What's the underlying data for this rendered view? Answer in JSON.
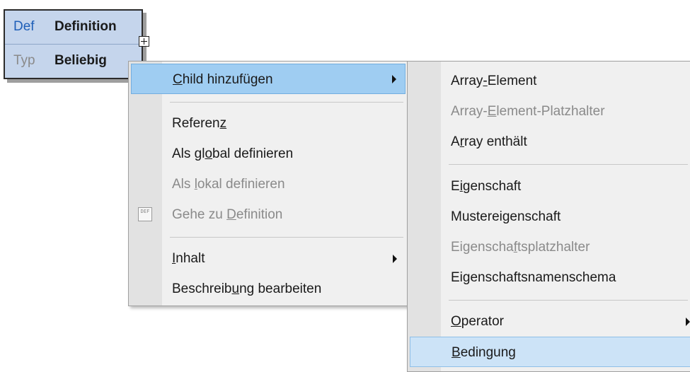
{
  "node": {
    "rows": [
      {
        "key": "Def",
        "value": "Definition"
      },
      {
        "key": "Typ",
        "value": "Beliebig"
      }
    ]
  },
  "context_menu": {
    "items": [
      {
        "pre": "",
        "u": "C",
        "post": "hild hinzufügen",
        "state": "highlighted",
        "submenu": true
      },
      {
        "pre": "Referen",
        "u": "z",
        "post": "",
        "state": "enabled"
      },
      {
        "pre": "Als gl",
        "u": "o",
        "post": "bal definieren",
        "state": "enabled"
      },
      {
        "pre": "Als ",
        "u": "l",
        "post": "okal definieren",
        "state": "disabled"
      },
      {
        "pre": "Gehe zu ",
        "u": "D",
        "post": "efinition",
        "state": "disabled",
        "icon": "goto-definition-icon",
        "icon_text": "DEF"
      },
      {
        "pre": "",
        "u": "I",
        "post": "nhalt",
        "state": "enabled",
        "submenu": true
      },
      {
        "pre": "Beschreib",
        "u": "u",
        "post": "ng bearbeiten",
        "state": "enabled"
      }
    ]
  },
  "submenu": {
    "items": [
      {
        "pre": "Array",
        "u": "-",
        "post": "Element",
        "state": "enabled"
      },
      {
        "pre": "Array-",
        "u": "E",
        "post": "lement-Platzhalter",
        "state": "disabled"
      },
      {
        "pre": "A",
        "u": "r",
        "post": "ray enthält",
        "state": "enabled"
      },
      {
        "pre": "E",
        "u": "i",
        "post": "genschaft",
        "state": "enabled"
      },
      {
        "pre": "Mustereigenschaft",
        "u": "",
        "post": "",
        "state": "enabled"
      },
      {
        "pre": "Eigenscha",
        "u": "f",
        "post": "tsplatzhalter",
        "state": "disabled"
      },
      {
        "pre": "Eigenschaftsnamenschema",
        "u": "",
        "post": "",
        "state": "enabled"
      },
      {
        "pre": "",
        "u": "O",
        "post": "perator",
        "state": "enabled",
        "submenu": true
      },
      {
        "pre": "",
        "u": "B",
        "post": "edingung",
        "state": "highlighted"
      }
    ]
  }
}
